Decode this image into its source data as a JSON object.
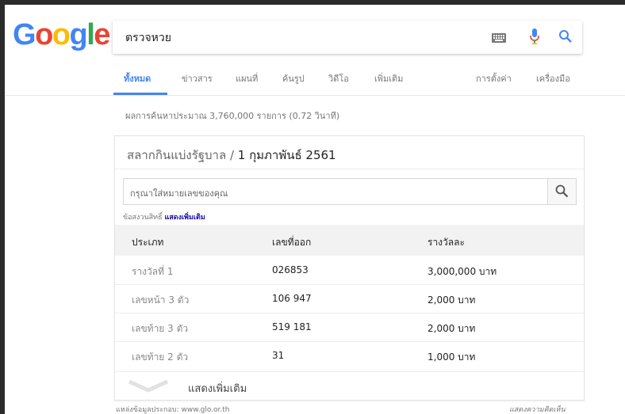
{
  "logo": {
    "letters": [
      "G",
      "o",
      "o",
      "g",
      "l",
      "e"
    ],
    "colors": [
      "#4285f4",
      "#ea4335",
      "#fbbc05",
      "#4285f4",
      "#34a853",
      "#ea4335"
    ]
  },
  "search": {
    "query": "ตรวจหวย",
    "icons": [
      "keyboard-icon",
      "microphone-icon",
      "search-icon"
    ]
  },
  "tabs": [
    {
      "label": "ทั้งหมด",
      "active": true
    },
    {
      "label": "ข่าวสาร",
      "active": false
    },
    {
      "label": "แผนที่",
      "active": false
    },
    {
      "label": "ค้นรูป",
      "active": false
    },
    {
      "label": "วิดีโอ",
      "active": false
    },
    {
      "label": "เพิ่มเติม",
      "active": false
    },
    {
      "label": "การตั้งค่า",
      "active": false
    },
    {
      "label": "เครื่องมือ",
      "active": false
    }
  ],
  "stats": "ผลการค้นหาประมาณ 3,760,000 รายการ (0.72 วินาที)",
  "card": {
    "title_prefix": "สลากกินแบ่งรัฐบาล / ",
    "title_date": "1 กุมภาพันธ์ 2561",
    "input_placeholder": "กรุณาใส่หมายเลขของคุณ",
    "rights_text": "ข้อสงวนสิทธิ์ ",
    "rights_link": "แสดงเพิ่มเติม",
    "headers": [
      "ประเภท",
      "เลขที่ออก",
      "รางวัลละ"
    ],
    "rows": [
      {
        "type": "รางวัลที่ 1",
        "number": "026853",
        "prize": "3,000,000 บาท"
      },
      {
        "type": "เลขหน้า 3 ตัว",
        "number": "106 947",
        "prize": "2,000 บาท"
      },
      {
        "type": "เลขท้าย 3 ตัว",
        "number": "519 181",
        "prize": "2,000 บาท"
      },
      {
        "type": "เลขท้าย 2 ตัว",
        "number": "31",
        "prize": "1,000 บาท"
      }
    ],
    "show_more": "แสดงเพิ่มเติม"
  },
  "footer": {
    "source": "แหล่งข้อมูลประกอบ: www.glo.or.th",
    "feedback": "แสดงความคิดเห็น"
  }
}
